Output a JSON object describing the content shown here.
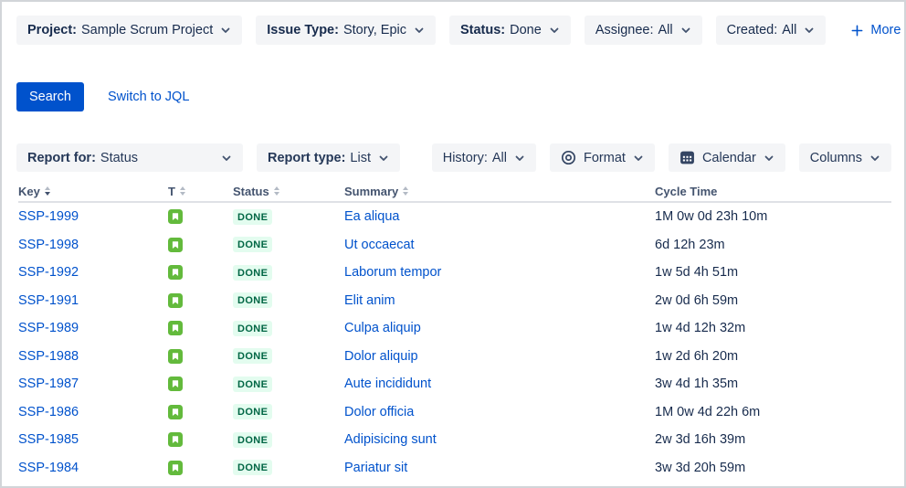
{
  "filters": {
    "chips": [
      {
        "label": "Project:",
        "value": "Sample Scrum Project",
        "bold_label": true
      },
      {
        "label": "Issue Type:",
        "value": "Story, Epic",
        "bold_label": true
      },
      {
        "label": "Status:",
        "value": "Done",
        "bold_label": true
      },
      {
        "label": "Assignee:",
        "value": "All",
        "bold_label": false
      },
      {
        "label": "Created:",
        "value": "All",
        "bold_label": false
      }
    ],
    "more_label": "More"
  },
  "actions": {
    "search_label": "Search",
    "switch_jql_label": "Switch to JQL"
  },
  "report_controls": {
    "report_for": {
      "label": "Report for:",
      "value": "Status"
    },
    "report_type": {
      "label": "Report type:",
      "value": "List"
    },
    "history": {
      "label": "History:",
      "value": "All"
    },
    "format_label": "Format",
    "calendar_label": "Calendar",
    "columns_label": "Columns"
  },
  "table": {
    "columns": [
      {
        "label": "Key",
        "sortable": true,
        "sorted": "desc"
      },
      {
        "label": "T",
        "sortable": true,
        "sorted": null
      },
      {
        "label": "Status",
        "sortable": true,
        "sorted": null
      },
      {
        "label": "Summary",
        "sortable": true,
        "sorted": null
      },
      {
        "label": "Cycle Time",
        "sortable": false,
        "sorted": null
      }
    ],
    "rows": [
      {
        "key": "SSP-1999",
        "type": "story",
        "status": "DONE",
        "summary": "Ea aliqua",
        "cycle_time": "1M 0w 0d 23h 10m"
      },
      {
        "key": "SSP-1998",
        "type": "story",
        "status": "DONE",
        "summary": "Ut occaecat",
        "cycle_time": "6d 12h 23m"
      },
      {
        "key": "SSP-1992",
        "type": "story",
        "status": "DONE",
        "summary": "Laborum tempor",
        "cycle_time": "1w 5d 4h 51m"
      },
      {
        "key": "SSP-1991",
        "type": "story",
        "status": "DONE",
        "summary": "Elit anim",
        "cycle_time": "2w 0d 6h 59m"
      },
      {
        "key": "SSP-1989",
        "type": "story",
        "status": "DONE",
        "summary": "Culpa aliquip",
        "cycle_time": "1w 4d 12h 32m"
      },
      {
        "key": "SSP-1988",
        "type": "story",
        "status": "DONE",
        "summary": "Dolor aliquip",
        "cycle_time": "1w 2d 6h 20m"
      },
      {
        "key": "SSP-1987",
        "type": "story",
        "status": "DONE",
        "summary": "Aute incididunt",
        "cycle_time": "3w 4d 1h 35m"
      },
      {
        "key": "SSP-1986",
        "type": "story",
        "status": "DONE",
        "summary": "Dolor officia",
        "cycle_time": "1M 0w 4d 22h 6m"
      },
      {
        "key": "SSP-1985",
        "type": "story",
        "status": "DONE",
        "summary": "Adipisicing sunt",
        "cycle_time": "2w 3d 16h 39m"
      },
      {
        "key": "SSP-1984",
        "type": "story",
        "status": "DONE",
        "summary": "Pariatur sit",
        "cycle_time": "3w 3d 20h 59m"
      }
    ]
  },
  "colors": {
    "accent_blue": "#0052CC",
    "chip_background": "#F4F5F7",
    "text_primary": "#172B4D",
    "text_secondary": "#44546F",
    "status_done_background": "#E3FCEF",
    "status_done_text": "#006644",
    "story_icon_green": "#63BA3C",
    "header_divider": "#DFE1E6"
  }
}
